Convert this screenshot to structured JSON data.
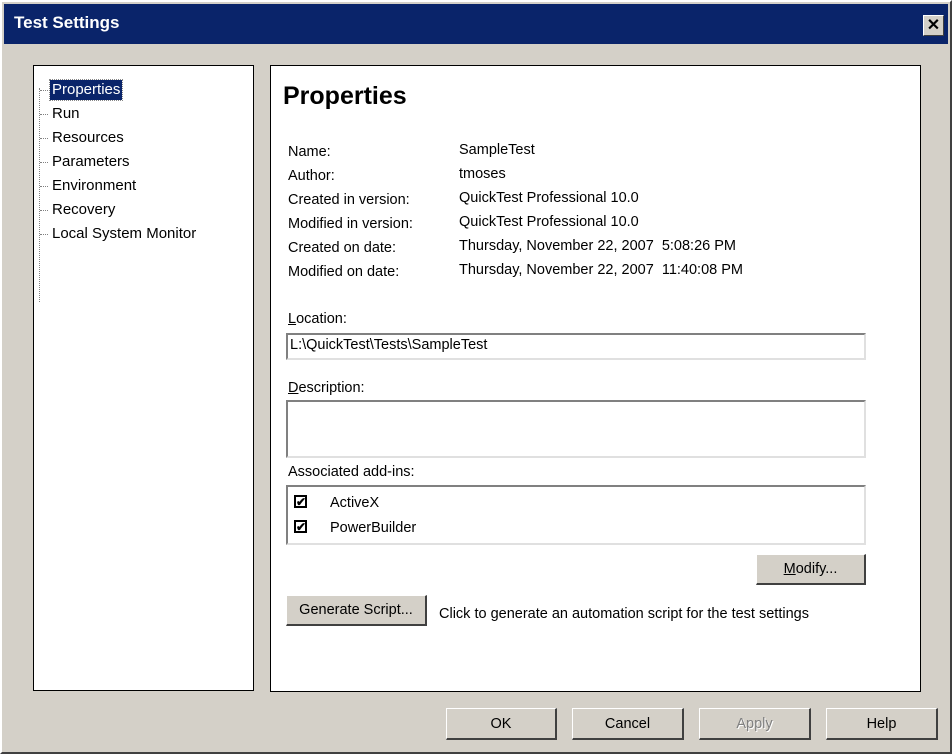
{
  "window": {
    "title": "Test Settings",
    "close_glyph": "✕"
  },
  "tree": {
    "items": [
      {
        "label": "Properties",
        "selected": true
      },
      {
        "label": "Run"
      },
      {
        "label": "Resources"
      },
      {
        "label": "Parameters"
      },
      {
        "label": "Environment"
      },
      {
        "label": "Recovery"
      },
      {
        "label": "Local System Monitor"
      }
    ]
  },
  "panel": {
    "heading": "Properties",
    "properties": [
      {
        "label": "Name:",
        "value": "SampleTest"
      },
      {
        "label": "Author:",
        "value": "tmoses"
      },
      {
        "label": "Created in version:",
        "value": "QuickTest Professional 10.0"
      },
      {
        "label": "Modified in version:",
        "value": "QuickTest Professional 10.0"
      },
      {
        "label": "Created on date:",
        "value": "Thursday, November 22, 2007  5:08:26 PM"
      },
      {
        "label": "Modified on date:",
        "value": "Thursday, November 22, 2007  11:40:08 PM"
      }
    ],
    "location": {
      "label_first": "L",
      "label_rest": "ocation:",
      "value": "L:\\QuickTest\\Tests\\SampleTest"
    },
    "description": {
      "label_first": "D",
      "label_rest": "escription:",
      "value": ""
    },
    "addins": {
      "label": "Associated add-ins:",
      "items": [
        {
          "label": "ActiveX",
          "checked": true,
          "mark": "✔"
        },
        {
          "label": "PowerBuilder",
          "checked": true,
          "mark": "✔"
        }
      ]
    },
    "modify_button": {
      "first": "M",
      "rest": "odify..."
    },
    "generate_button": {
      "label": "Generate Script..."
    },
    "generate_hint": "Click to generate an automation script for the test settings"
  },
  "footer": {
    "ok": "OK",
    "cancel": "Cancel",
    "apply": "Apply",
    "help": "Help"
  }
}
